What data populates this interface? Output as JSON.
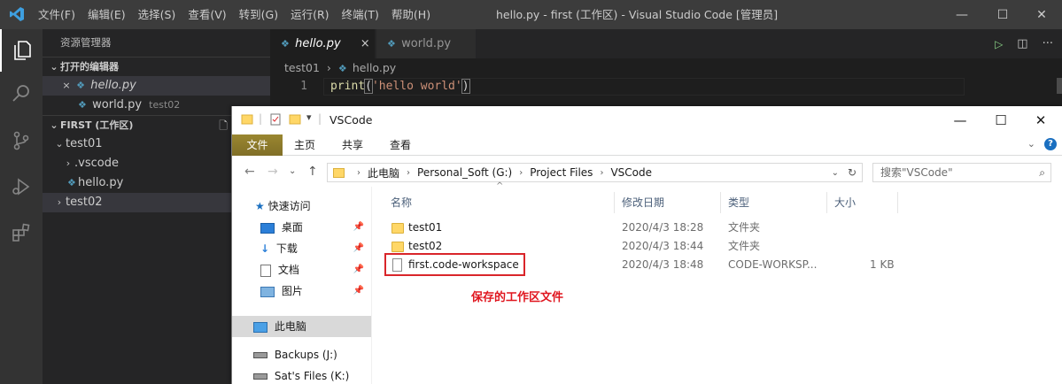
{
  "vscode": {
    "menu": [
      "文件(F)",
      "编辑(E)",
      "选择(S)",
      "查看(V)",
      "转到(G)",
      "运行(R)",
      "终端(T)",
      "帮助(H)"
    ],
    "window_title": "hello.py - first (工作区) - Visual Studio Code [管理员]",
    "sidebar": {
      "title": "资源管理器",
      "open_editors_header": "打开的编辑器",
      "open_editors": [
        {
          "name": "hello.py",
          "close": "×"
        },
        {
          "name": "world.py",
          "folder": "test02"
        }
      ],
      "workspace_header": "FIRST (工作区)",
      "tree": [
        {
          "label": "test01",
          "chevron": "⌄"
        },
        {
          "label": ".vscode",
          "chevron": "›"
        },
        {
          "label": "hello.py"
        },
        {
          "label": "test02",
          "chevron": "›"
        }
      ]
    },
    "tabs": [
      {
        "label": "hello.py",
        "close": "×"
      },
      {
        "label": "world.py"
      }
    ],
    "breadcrumb": {
      "folder": "test01",
      "file": "hello.py"
    },
    "editor": {
      "line_number": "1",
      "code_fn": "print",
      "code_open": "(",
      "code_str": "'hello world'",
      "code_close": ")"
    }
  },
  "explorer": {
    "title": "VSCode",
    "ribbon_tabs": [
      "文件",
      "主页",
      "共享",
      "查看"
    ],
    "address": [
      "此电脑",
      "Personal_Soft (G:)",
      "Project Files",
      "VSCode"
    ],
    "search_placeholder": "搜索\"VSCode\"",
    "nav": [
      {
        "label": "快速访问"
      },
      {
        "label": "桌面"
      },
      {
        "label": "下载"
      },
      {
        "label": "文档"
      },
      {
        "label": "图片"
      },
      {
        "label": "此电脑"
      },
      {
        "label": "Backups (J:)"
      },
      {
        "label": "Sat's Files (K:)"
      }
    ],
    "columns": [
      "名称",
      "修改日期",
      "类型",
      "大小"
    ],
    "files": [
      {
        "name": "test01",
        "date": "2020/4/3 18:28",
        "type": "文件夹",
        "size": ""
      },
      {
        "name": "test02",
        "date": "2020/4/3 18:44",
        "type": "文件夹",
        "size": ""
      },
      {
        "name": "first.code-workspace",
        "date": "2020/4/3 18:48",
        "type": "CODE-WORKSP...",
        "size": "1 KB"
      }
    ],
    "annotation": "保存的工作区文件"
  },
  "colors": {
    "vscode_title": "#3c3c3c",
    "activity_bar": "#333333",
    "sidebar": "#252526",
    "editor": "#1e1e1e",
    "python_icon": "#519aba",
    "ribbon_file": "#8c7a2c",
    "annotation_red": "#e0161f"
  }
}
